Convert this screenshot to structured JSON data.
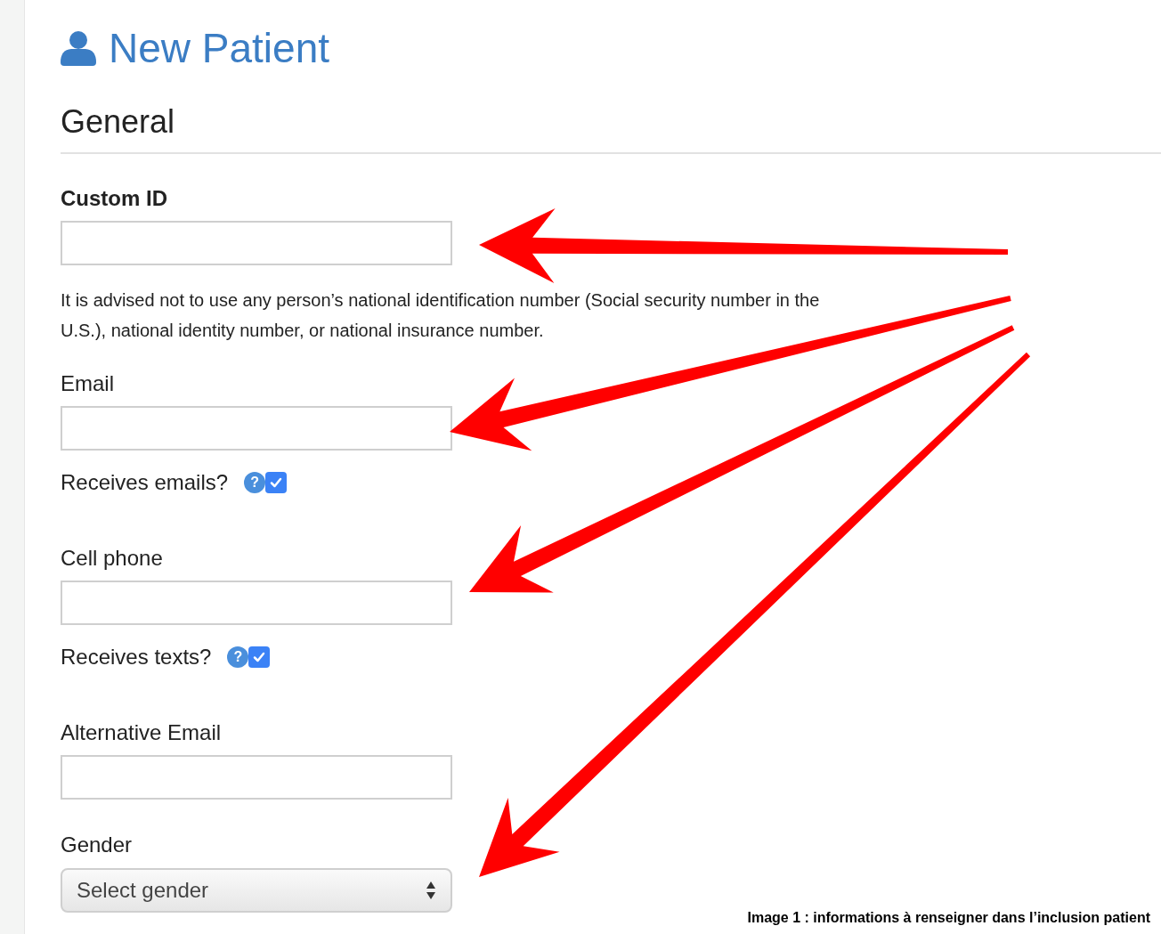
{
  "title": "New Patient",
  "section": "General",
  "fields": [
    {
      "kind": "text",
      "label": "Custom ID",
      "emphasized": true
    },
    {
      "kind": "note",
      "text": "It is advised not to use any person’s national identification number (Social security number in the U.S.), national identity number, or national insurance number."
    },
    {
      "kind": "text",
      "label": "Email",
      "emphasized": false
    },
    {
      "kind": "checkbox",
      "label": "Receives emails?",
      "help": "?",
      "checked": true
    },
    {
      "kind": "text",
      "label": "Cell phone",
      "emphasized": false
    },
    {
      "kind": "checkbox",
      "label": "Receives texts?",
      "help": "?",
      "checked": true
    },
    {
      "kind": "text",
      "label": "Alternative Email",
      "emphasized": false
    },
    {
      "kind": "select",
      "label": "Gender",
      "value": "Select gender"
    }
  ],
  "caption": "Image 1 : informations à renseigner dans l’inclusion patient"
}
